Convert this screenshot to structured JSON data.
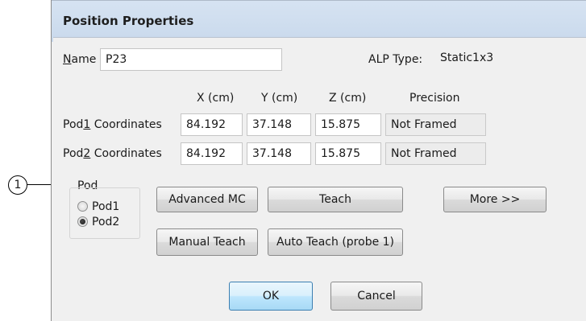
{
  "window": {
    "title": "Position Properties"
  },
  "name": {
    "label_prefix": "",
    "label_underlined": "N",
    "label_rest": "ame",
    "value": "P23"
  },
  "alp_type": {
    "label": "ALP Type:",
    "value": "Static1x3"
  },
  "columns": {
    "x": "X (cm)",
    "y": "Y (cm)",
    "z": "Z (cm)",
    "precision": "Precision"
  },
  "rows": [
    {
      "label_prefix": "Pod",
      "label_underlined": "1",
      "label_rest": " Coordinates",
      "x": "84.192",
      "y": "37.148",
      "z": "15.875",
      "precision": "Not Framed"
    },
    {
      "label_prefix": "Pod",
      "label_underlined": "2",
      "label_rest": " Coordinates",
      "x": "84.192",
      "y": "37.148",
      "z": "15.875",
      "precision": "Not Framed"
    }
  ],
  "pod_group": {
    "title": "Pod",
    "options": [
      {
        "label": "Pod1",
        "checked": false
      },
      {
        "label": "Pod2",
        "checked": true
      }
    ]
  },
  "buttons": {
    "advanced_mc": "Advanced MC",
    "teach": "Teach",
    "more": "More >>",
    "manual_teach": "Manual Teach",
    "auto_teach": "Auto Teach (probe 1)",
    "ok": "OK",
    "cancel": "Cancel"
  },
  "callout": {
    "number": "1"
  }
}
